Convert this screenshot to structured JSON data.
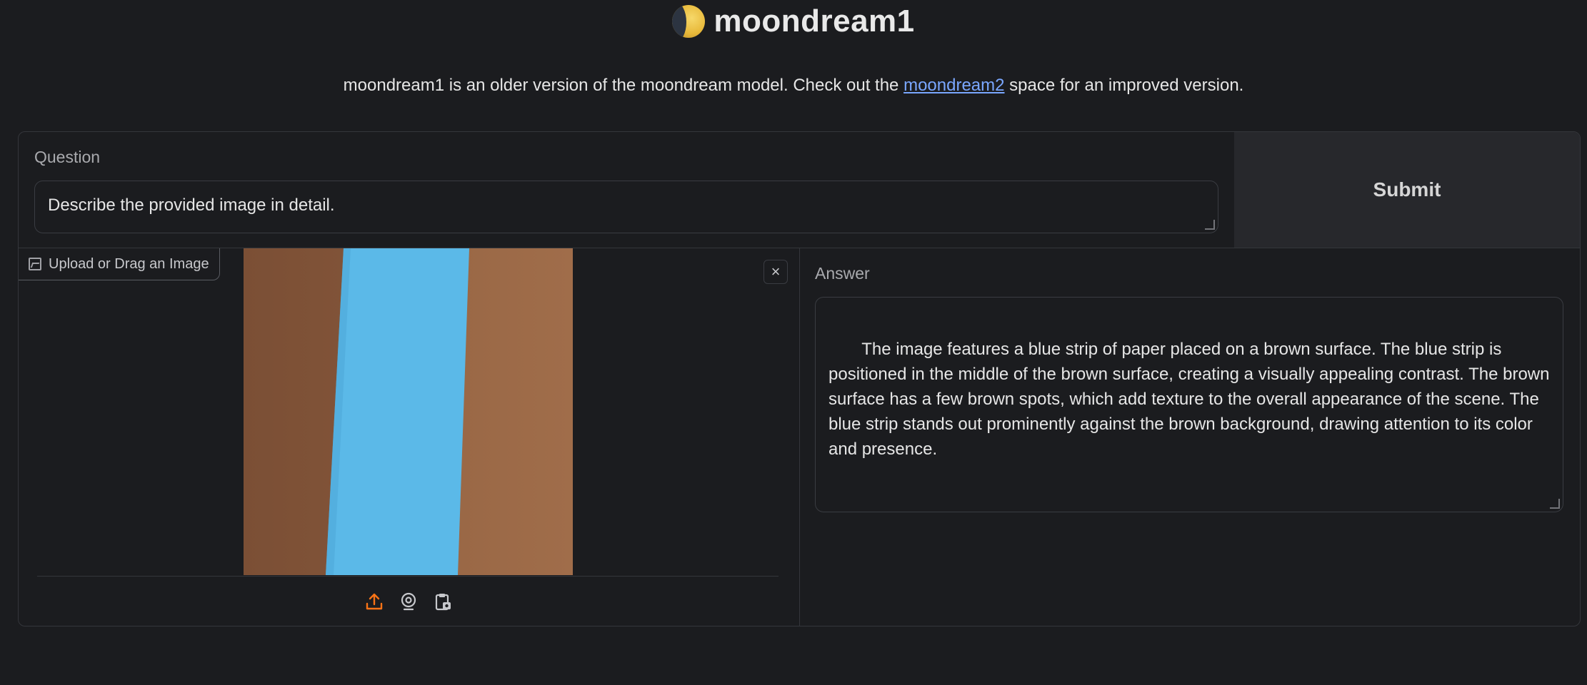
{
  "header": {
    "title": "moondream1",
    "subtitle_pre": "moondream1 is an older version of the moondream model. Check out the ",
    "subtitle_link": "moondream2",
    "subtitle_post": " space for an improved version."
  },
  "question": {
    "label": "Question",
    "value": "Describe the provided image in detail."
  },
  "submit_label": "Submit",
  "image_input": {
    "tab_label": "Upload or Drag an Image",
    "close_symbol": "×",
    "source_icons": [
      "upload-icon",
      "webcam-icon",
      "clipboard-icon"
    ],
    "accent_color": "#f97316"
  },
  "answer": {
    "label": "Answer",
    "value": " The image features a blue strip of paper placed on a brown surface. The blue strip is positioned in the middle of the brown surface, creating a visually appealing contrast. The brown surface has a few brown spots, which add texture to the overall appearance of the scene. The blue strip stands out prominently against the brown background, drawing attention to its color and presence."
  },
  "colors": {
    "background": "#1b1c1f",
    "link": "#7aa7ff",
    "photo_brown": "#8a5b3c",
    "photo_blue": "#5ab8e6"
  }
}
